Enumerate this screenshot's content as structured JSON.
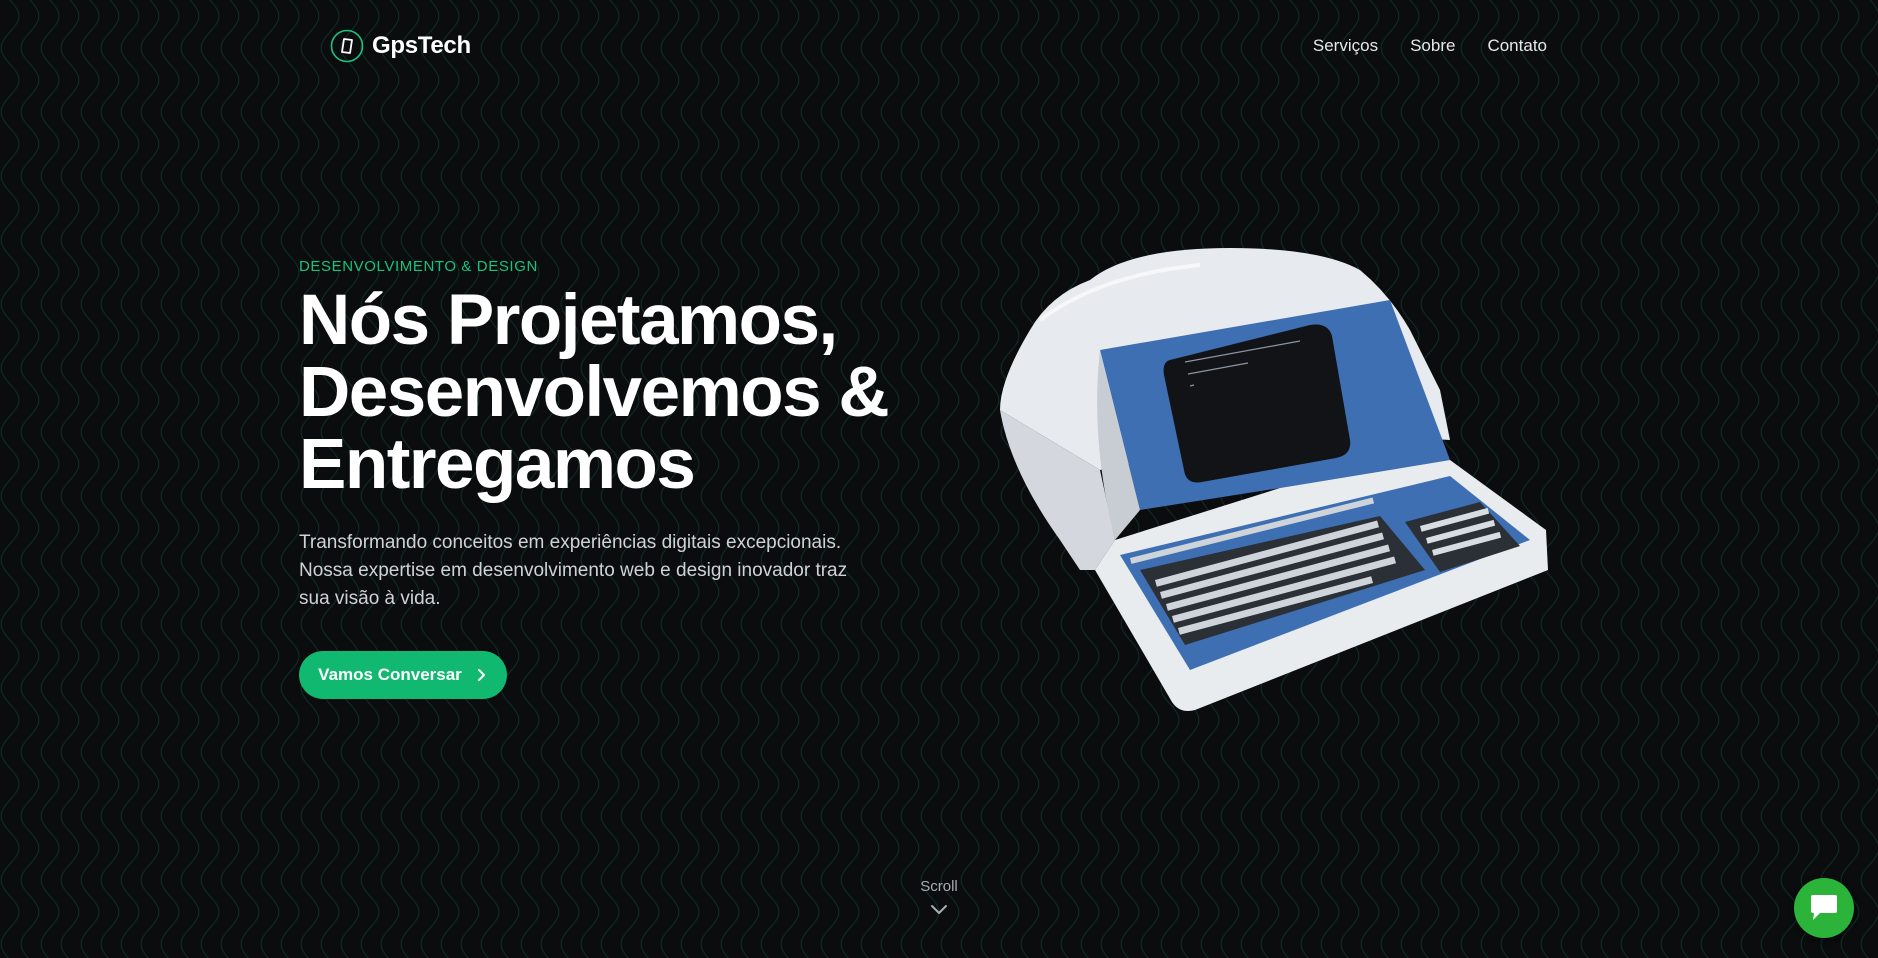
{
  "brand": {
    "name": "GpsTech",
    "accent": "#19c37d",
    "cta_color": "#10b96f",
    "chat_color": "#2bb33a",
    "background": "#0b0c0e"
  },
  "nav": {
    "items": [
      "Serviços",
      "Sobre",
      "Contato"
    ]
  },
  "hero": {
    "eyebrow": "DESENVOLVIMENTO & DESIGN",
    "title_lines": [
      "Nós Projetamos,",
      "Desenvolvemos &",
      "Entregamos"
    ],
    "description": "Transformando conceitos em experiências digitais excepcionais. Nossa expertise em desenvolvimento web e design inovador traz sua visão à vida.",
    "cta_label": "Vamos Conversar",
    "cta_icon": "chevron-right-icon"
  },
  "scroll": {
    "label": "Scroll",
    "icon": "chevron-down-icon"
  },
  "chat": {
    "icon": "chat-bubble-icon"
  }
}
